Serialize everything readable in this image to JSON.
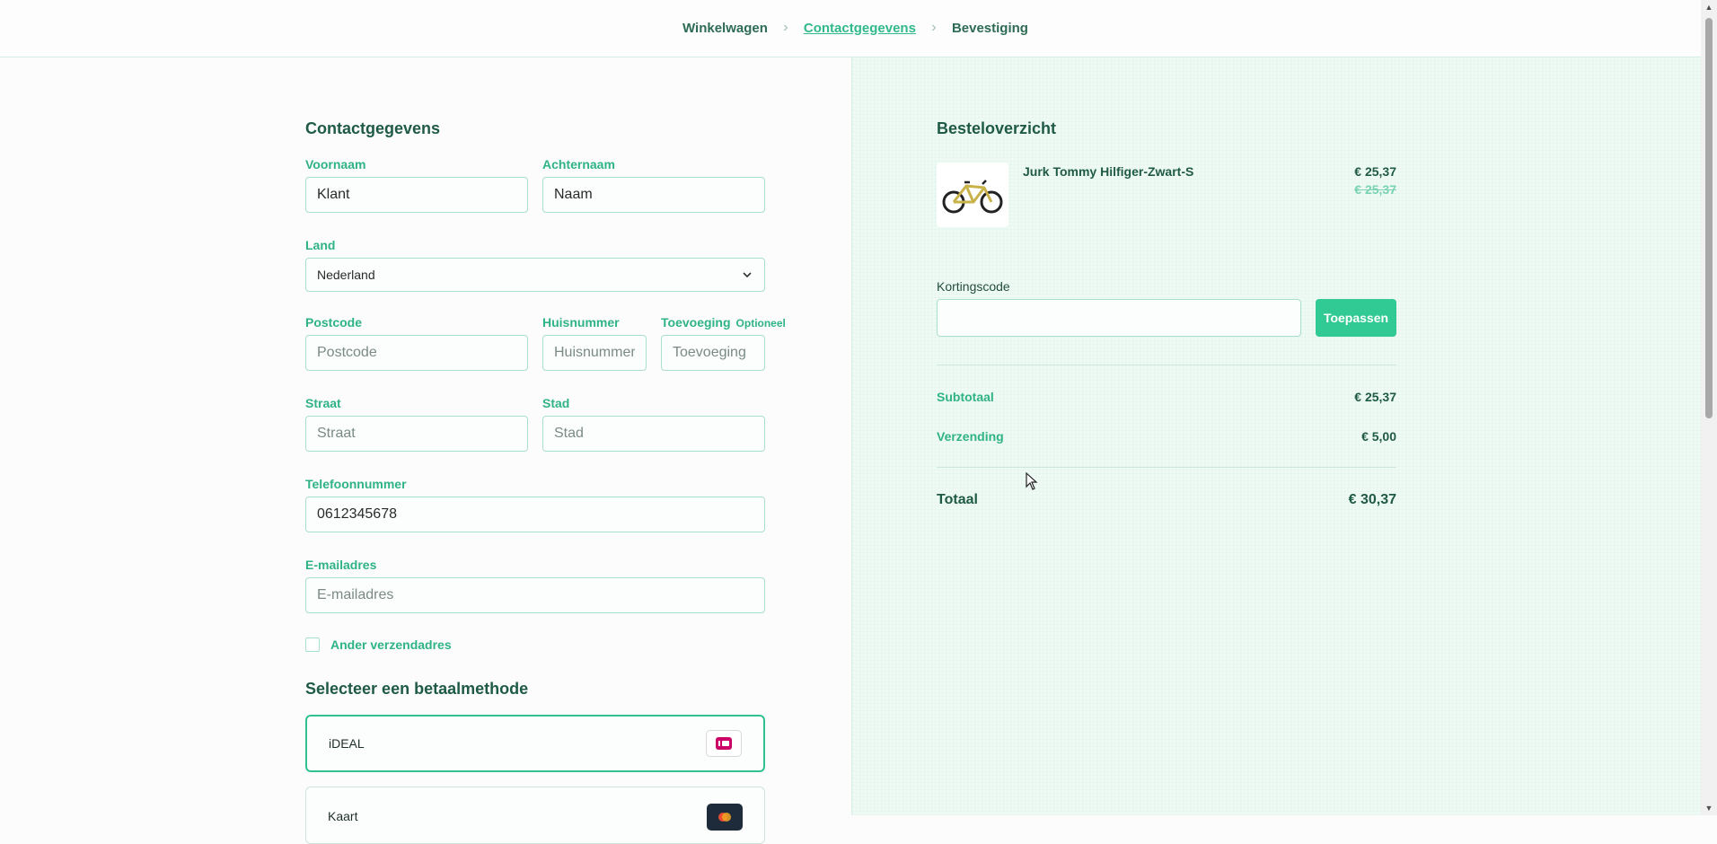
{
  "breadcrumb": {
    "steps": [
      {
        "label": "Winkelwagen"
      },
      {
        "label": "Contactgegevens"
      },
      {
        "label": "Bevestiging"
      }
    ]
  },
  "contact": {
    "title": "Contactgegevens",
    "first_name": {
      "label": "Voornaam",
      "value": "Klant"
    },
    "last_name": {
      "label": "Achternaam",
      "value": "Naam"
    },
    "country": {
      "label": "Land",
      "value": "Nederland"
    },
    "postcode": {
      "label": "Postcode",
      "placeholder": "Postcode"
    },
    "house_number": {
      "label": "Huisnummer",
      "placeholder": "Huisnummer"
    },
    "addition": {
      "label": "Toevoeging",
      "optional": "Optioneel",
      "placeholder": "Toevoeging"
    },
    "street": {
      "label": "Straat",
      "placeholder": "Straat"
    },
    "city": {
      "label": "Stad",
      "placeholder": "Stad"
    },
    "phone": {
      "label": "Telefoonnummer",
      "value": "0612345678"
    },
    "email": {
      "label": "E-mailadres",
      "placeholder": "E-mailadres"
    },
    "other_address": "Ander verzendadres"
  },
  "payment": {
    "title": "Selecteer een betaalmethode",
    "methods": [
      {
        "label": "iDEAL",
        "icon": "ideal-logo-icon"
      },
      {
        "label": "Kaart",
        "icon": "card-logo-icon"
      }
    ]
  },
  "order": {
    "title": "Besteloverzicht",
    "item": {
      "name": "Jurk Tommy Hilfiger-Zwart-S",
      "price": "€ 25,37",
      "old_price": "€ 25,37",
      "image_icon": "bicycle-icon"
    },
    "discount": {
      "label": "Kortingscode",
      "placeholder": "",
      "button": "Toepassen"
    },
    "subtotal": {
      "label": "Subtotaal",
      "value": "€ 25,37"
    },
    "shipping": {
      "label": "Verzending",
      "value": "€ 5,00"
    },
    "total": {
      "label": "Totaal",
      "value": "€ 30,37"
    }
  },
  "colors": {
    "accent": "#31c994",
    "dark_green": "#1f5a46"
  }
}
